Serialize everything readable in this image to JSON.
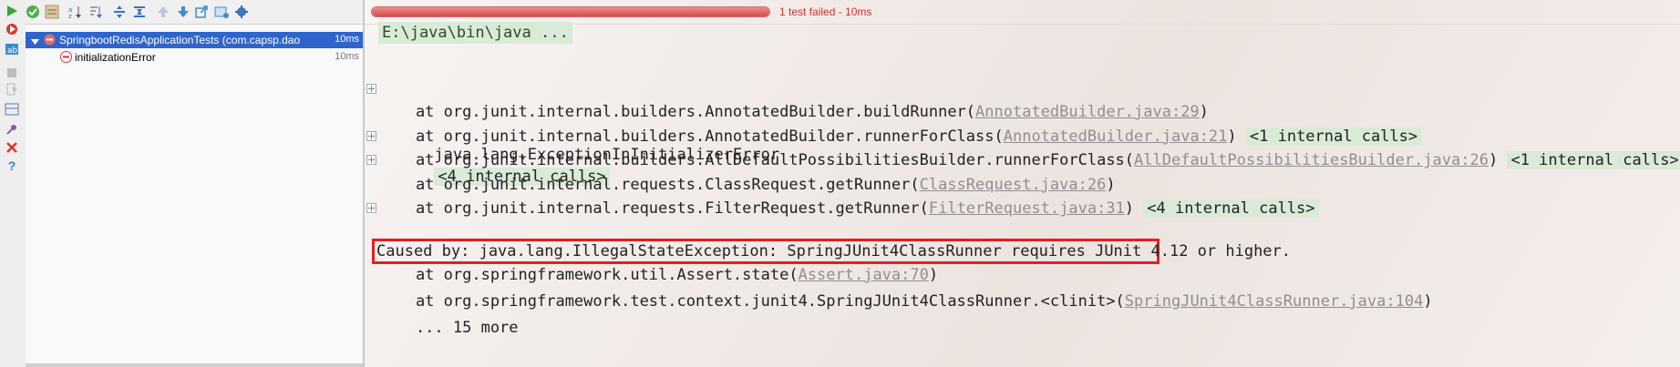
{
  "left_toolbar": {
    "icons": [
      "run-icon",
      "rerun-failed-icon",
      "toggle-auto-test-icon",
      "stop-icon",
      "exit-icon",
      "layout-icon",
      "pin-icon",
      "close-icon",
      "help-icon"
    ]
  },
  "top_toolbar": {
    "icons": [
      "show-passed-icon",
      "show-ignored-icon",
      "sort-alpha-icon",
      "sort-duration-icon",
      "expand-all-icon",
      "collapse-all-icon",
      "prev-failed-icon",
      "next-failed-icon",
      "export-icon",
      "import-icon",
      "settings-icon"
    ]
  },
  "tree": {
    "root": {
      "label": "SpringbootRedisApplicationTests (com.capsp.dao",
      "time": "10ms"
    },
    "child": {
      "label": "initializationError",
      "time": "10ms"
    }
  },
  "progress": {
    "fraction": 1.0,
    "status": "1 test failed - 10ms",
    "color": "#d34a4a"
  },
  "console": {
    "command": "E:\\java\\bin\\java ...",
    "exception": "java.lang.ExceptionInInitializerError",
    "exception_internal": "<4 internal calls>",
    "frames": [
      {
        "prefix": "    at org.junit.internal.builders.AnnotatedBuilder.buildRunner(",
        "link": "AnnotatedBuilder.java:29",
        "suffix": ")",
        "internal": ""
      },
      {
        "prefix": "    at org.junit.internal.builders.AnnotatedBuilder.runnerForClass(",
        "link": "AnnotatedBuilder.java:21",
        "suffix": ")",
        "internal": "<1 internal calls>"
      },
      {
        "prefix": "    at org.junit.internal.builders.AllDefaultPossibilitiesBuilder.runnerForClass(",
        "link": "AllDefaultPossibilitiesBuilder.java:26",
        "suffix": ")",
        "internal": "<1 internal calls>"
      },
      {
        "prefix": "    at org.junit.internal.requests.ClassRequest.getRunner(",
        "link": "ClassRequest.java:26",
        "suffix": ")",
        "internal": ""
      },
      {
        "prefix": "    at org.junit.internal.requests.FilterRequest.getRunner(",
        "link": "FilterRequest.java:31",
        "suffix": ")",
        "internal": "<4 internal calls>"
      }
    ],
    "caused_by": "Caused by: java.lang.IllegalStateException: SpringJUnit4ClassRunner requires JUnit 4.12 or higher.",
    "cause_frames": [
      {
        "prefix": "    at org.springframework.util.Assert.state(",
        "link": "Assert.java:70",
        "suffix": ")"
      },
      {
        "prefix": "    at org.springframework.test.context.junit4.SpringJUnit4ClassRunner.<clinit>(",
        "link": "SpringJUnit4ClassRunner.java:104",
        "suffix": ")"
      }
    ],
    "more": "    ... 15 more"
  }
}
